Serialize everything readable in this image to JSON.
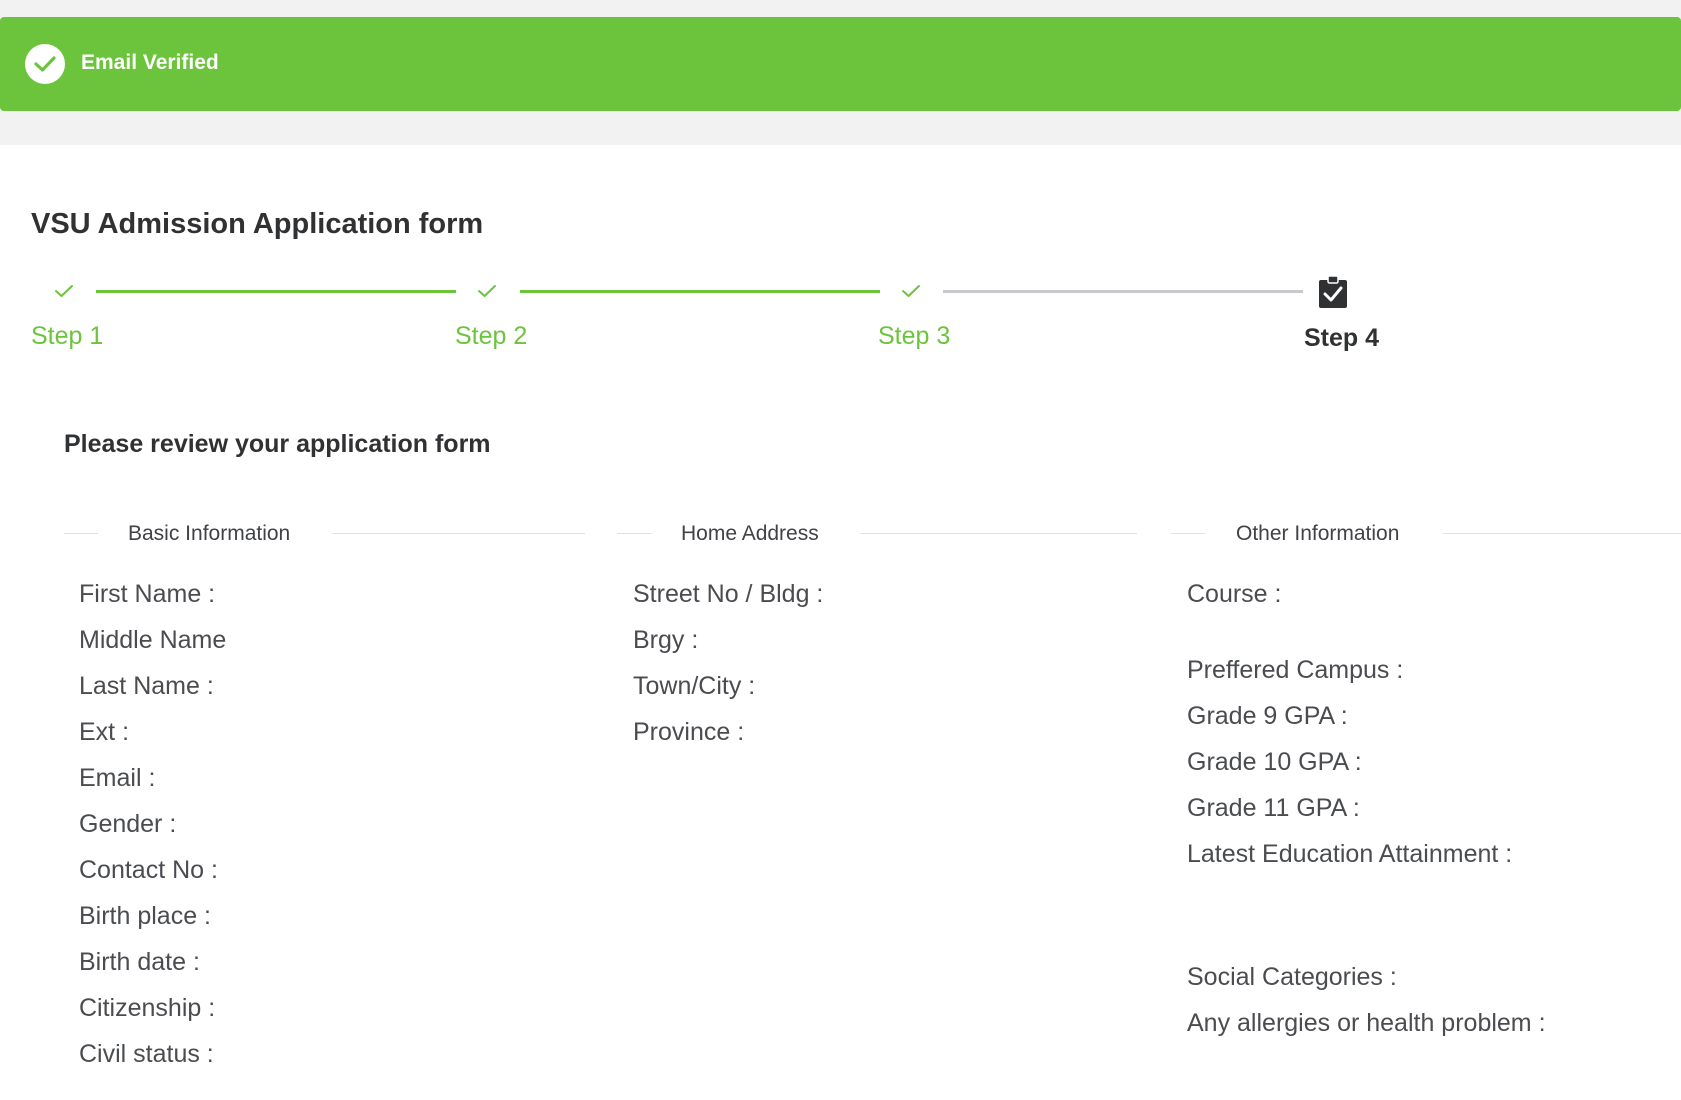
{
  "banner": {
    "text": "Email Verified",
    "color": "#6cc43c",
    "icon": "check-circle-icon"
  },
  "form": {
    "title": "VSU Admission Application form"
  },
  "steps": [
    {
      "label": "Step 1",
      "status": "done",
      "icon": "check-icon"
    },
    {
      "label": "Step 2",
      "status": "done",
      "icon": "check-icon"
    },
    {
      "label": "Step 3",
      "status": "done",
      "icon": "check-icon"
    },
    {
      "label": "Step 4",
      "status": "current",
      "icon": "clipboard-check-icon"
    }
  ],
  "review": {
    "title": "Please review your application form"
  },
  "sections": {
    "basic": {
      "title": "Basic Information",
      "fields": [
        "First Name :",
        "Middle Name",
        "Last Name :",
        "Ext :",
        "Email :",
        "Gender :",
        "Contact No :",
        "Birth place :",
        "Birth date :",
        "Citizenship :",
        "Civil status :"
      ]
    },
    "address": {
      "title": "Home Address",
      "fields": [
        "Street No / Bldg :",
        "Brgy :",
        "Town/City :",
        "Province :"
      ]
    },
    "other": {
      "title": "Other Information",
      "fields": [
        "Course :",
        "Preffered Campus :",
        "Grade 9 GPA :",
        "Grade 10 GPA :",
        "Grade 11 GPA :",
        "Latest Education Attainment :",
        "Social Categories :",
        "Any allergies or health problem :"
      ]
    }
  },
  "colors": {
    "accent": "#6cc43c",
    "inactive_line": "#c8c9cc",
    "text": "#303133"
  }
}
